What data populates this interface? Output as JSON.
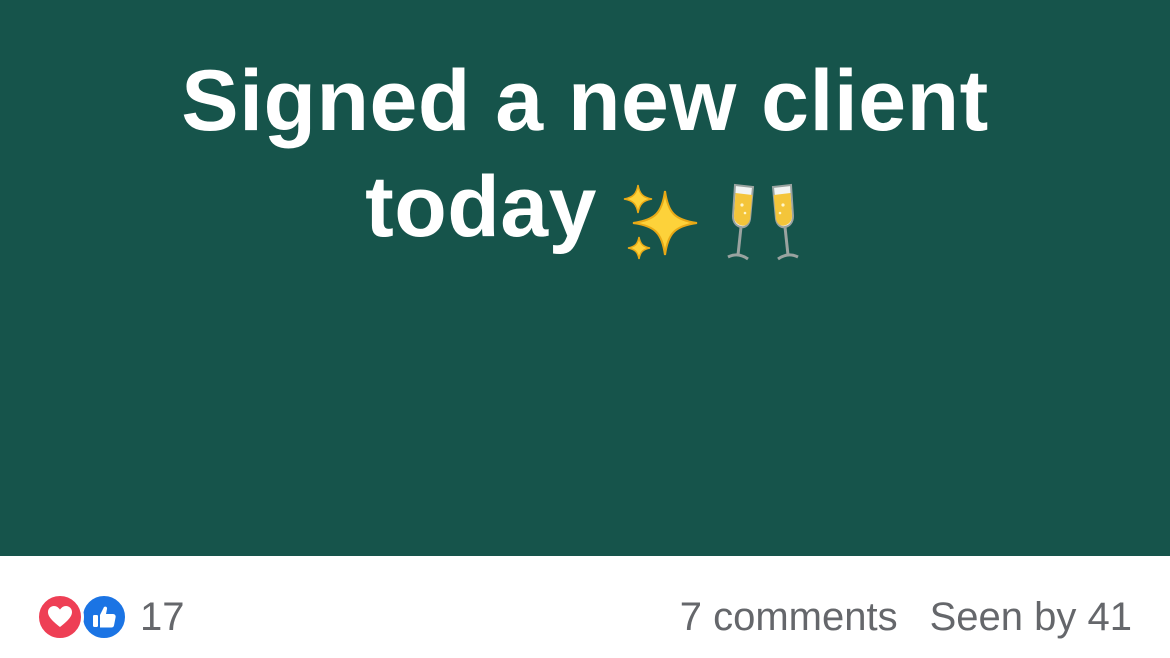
{
  "post": {
    "status_text_line1": "Signed a new client",
    "status_text_line2": "today",
    "emojis": [
      "sparkles-icon",
      "clinking-glasses-icon"
    ],
    "background_color": "#16544b",
    "text_color": "#ffffff"
  },
  "footer": {
    "reaction_icons": [
      "love-reaction-icon",
      "like-reaction-icon"
    ],
    "reaction_count": "17",
    "comments_label": "7 comments",
    "seen_label": "Seen by 41",
    "love_color": "#ee3f55",
    "like_color": "#1b74e4",
    "meta_text_color": "#65676b"
  }
}
